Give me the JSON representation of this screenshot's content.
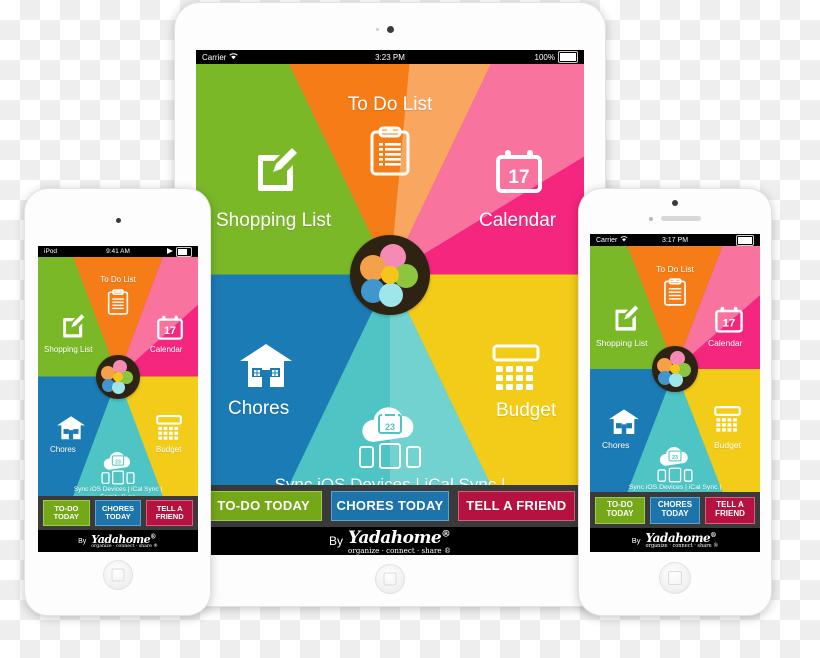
{
  "scene": {
    "background": "transparent-checkerboard",
    "devices": [
      "ipod-touch",
      "ipad",
      "iphone"
    ]
  },
  "palette": {
    "green": "#7ab828",
    "orange": "#f57c16",
    "pink": "#f5267e",
    "blue": "#1b7bb5",
    "teal": "#4ec4c4",
    "yellow": "#f2cc18",
    "orange_light": "#f9a661",
    "pink_light": "#f9739f",
    "teal_light": "#72d2d0",
    "btn_green": "#74a818",
    "btn_blue": "#1c74ab",
    "btn_crimson": "#b5123f",
    "bar_gray": "#3a3a3a",
    "black": "#000000"
  },
  "ipad": {
    "statusbar": {
      "carrier": "Carrier",
      "wifi_icon": "wifi-icon",
      "time": "3:23 PM",
      "battery_percent": "100%",
      "battery_icon": "battery-icon"
    },
    "tiles": [
      {
        "id": "shopping-list",
        "label": "Shopping List",
        "icon": "pencil-square-icon",
        "color": "#7ab828"
      },
      {
        "id": "to-do-list",
        "label": "To Do List",
        "icon": "clipboard-icon",
        "color": "#f57c16"
      },
      {
        "id": "calendar",
        "label": "Calendar",
        "icon": "calendar-icon",
        "color": "#f5267e",
        "icon_day": "17"
      },
      {
        "id": "chores",
        "label": "Chores",
        "icon": "house-icon",
        "color": "#1b7bb5"
      },
      {
        "id": "sync",
        "label": "Sync iOS Devices | iCal Sync |\nFamily Sync",
        "icon": "cloud-sync-icon",
        "color": "#4ec4c4",
        "icon_day": "23"
      },
      {
        "id": "budget",
        "label": "Budget",
        "icon": "calculator-icon",
        "color": "#f2cc18"
      }
    ],
    "logo": {
      "name": "yadahome-pinwheel-logo"
    },
    "buttons": [
      {
        "id": "to-do-today",
        "label": "TO-DO TODAY",
        "fill": "#74a818",
        "border": "#9ccb4f"
      },
      {
        "id": "chores-today",
        "label": "CHORES TODAY",
        "fill": "#1c74ab",
        "border": "#5ba3d0"
      },
      {
        "id": "tell-a-friend",
        "label": "TELL A FRIEND",
        "fill": "#b5123f",
        "border": "#dd5b80"
      }
    ],
    "footer": {
      "prefix": "By",
      "brand": "Yadahome",
      "registered": "®",
      "tagline": "organize · connect · share ®"
    },
    "home_button": "home-button"
  },
  "ipod": {
    "statusbar": {
      "carrier": "iPod",
      "time": "9:41 AM",
      "play_icon": "play-icon",
      "battery_icon": "battery-icon"
    },
    "tiles": [
      {
        "id": "shopping-list",
        "label": "Shopping List",
        "icon": "pencil-square-icon",
        "color": "#7ab828"
      },
      {
        "id": "to-do-list",
        "label": "To Do List",
        "icon": "clipboard-icon",
        "color": "#f57c16"
      },
      {
        "id": "calendar",
        "label": "Calendar",
        "icon": "calendar-icon",
        "color": "#f5267e",
        "icon_day": "17"
      },
      {
        "id": "chores",
        "label": "Chores",
        "icon": "house-icon",
        "color": "#1b7bb5"
      },
      {
        "id": "sync",
        "label": "Sync iOS Devices | iCal Sync |\nFamily Sync",
        "icon": "cloud-sync-icon",
        "color": "#4ec4c4",
        "icon_day": "23"
      },
      {
        "id": "budget",
        "label": "Budget",
        "icon": "calculator-icon",
        "color": "#f2cc18"
      }
    ],
    "buttons": [
      {
        "id": "to-do-today",
        "line1": "TO-DO",
        "line2": "TODAY",
        "fill": "#74a818",
        "border": "#9ccb4f"
      },
      {
        "id": "chores-today",
        "line1": "CHORES",
        "line2": "TODAY",
        "fill": "#1c74ab",
        "border": "#5ba3d0"
      },
      {
        "id": "tell-a-friend",
        "line1": "TELL A",
        "line2": "FRIEND",
        "fill": "#b5123f",
        "border": "#dd5b80"
      }
    ],
    "footer": {
      "prefix": "By",
      "brand": "Yadahome",
      "registered": "®",
      "tagline": "organize · connect · share ®"
    },
    "home_button": "home-button"
  },
  "iphone": {
    "statusbar": {
      "carrier": "Carrier",
      "wifi_icon": "wifi-icon",
      "time": "3:17 PM",
      "battery_icon": "battery-icon"
    },
    "tiles": [
      {
        "id": "shopping-list",
        "label": "Shopping List",
        "icon": "pencil-square-icon",
        "color": "#7ab828"
      },
      {
        "id": "to-do-list",
        "label": "To Do List",
        "icon": "clipboard-icon",
        "color": "#f57c16"
      },
      {
        "id": "calendar",
        "label": "Calendar",
        "icon": "calendar-icon",
        "color": "#f5267e",
        "icon_day": "17"
      },
      {
        "id": "chores",
        "label": "Chores",
        "icon": "house-icon",
        "color": "#1b7bb5"
      },
      {
        "id": "sync",
        "label": "Sync iOS Devices | iCal Sync |\nFamily Sync",
        "icon": "cloud-sync-icon",
        "color": "#4ec4c4",
        "icon_day": "23"
      },
      {
        "id": "budget",
        "label": "Budget",
        "icon": "calculator-icon",
        "color": "#f2cc18"
      }
    ],
    "buttons": [
      {
        "id": "to-do-today",
        "line1": "TO-DO",
        "line2": "TODAY",
        "fill": "#74a818",
        "border": "#9ccb4f"
      },
      {
        "id": "chores-today",
        "line1": "CHORES",
        "line2": "TODAY",
        "fill": "#1c74ab",
        "border": "#5ba3d0"
      },
      {
        "id": "tell-a-friend",
        "line1": "TELL A",
        "line2": "FRIEND",
        "fill": "#b5123f",
        "border": "#dd5b80"
      }
    ],
    "footer": {
      "prefix": "By",
      "brand": "Yadahome",
      "registered": "®",
      "tagline": "organize · connect · share ®"
    },
    "home_button": "home-button"
  }
}
